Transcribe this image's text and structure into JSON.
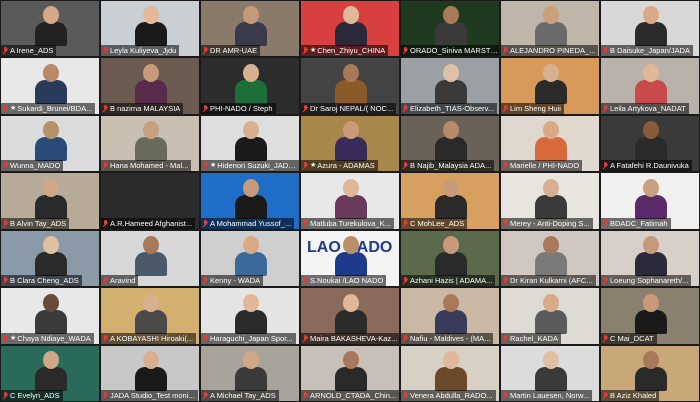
{
  "participants": [
    {
      "name": "A Irene_ADS",
      "bg": "#5a5a5a",
      "shirt": "#222222",
      "skin": "#d6a88a"
    },
    {
      "name": "Leyla Kuliyeva_Jjdu",
      "bg": "#c9cfd3",
      "shirt": "#1a1a1a",
      "skin": "#e3b99a"
    },
    {
      "name": "DR AMR-UAE",
      "bg": "#8a7a6a",
      "shirt": "#3a3a4a",
      "skin": "#c49a7a"
    },
    {
      "name": "Chen_Zhiyu_CHINA",
      "bg": "#d84040",
      "shirt": "#2a2a3a",
      "skin": "#e0b898",
      "star": true
    },
    {
      "name": "ORADO_Siniva MARSTE...",
      "bg": "#1f3a1f",
      "shirt": "#3a3a3a",
      "skin": "#a87a5a"
    },
    {
      "name": "ALEJANDRO PINEDA_...",
      "bg": "#bfb5a8",
      "shirt": "#6a6a6a",
      "skin": "#c9a07a"
    },
    {
      "name": "B Daisuke_Japan/JADA",
      "bg": "#d8d8d8",
      "shirt": "#2a2a2a",
      "skin": "#d8aa88"
    },
    {
      "name": "Sukardi_Brunei/BDA...",
      "bg": "#e8e8e8",
      "shirt": "#2a3a5a",
      "skin": "#b88a6a",
      "star": true
    },
    {
      "name": "B nazima MALAYSIA",
      "bg": "#6a5a50",
      "shirt": "#5a2a4a",
      "skin": "#c89a7a"
    },
    {
      "name": "PHI-NADO / Steph",
      "bg": "#2c2c2c",
      "shirt": "#1e6e3a",
      "skin": "#d8b090"
    },
    {
      "name": "Dr Saroj NEPAL/( NOC...",
      "bg": "#444444",
      "shirt": "#8a5a2a",
      "skin": "#a8785a"
    },
    {
      "name": "Elizabeth_TIAS-Observ...",
      "bg": "#9aa0a4",
      "shirt": "#3a3a3a",
      "skin": "#e0c0a8"
    },
    {
      "name": "Lim Sheng Huii",
      "bg": "#d89a5a",
      "shirt": "#2a2a2a",
      "skin": "#d8b090"
    },
    {
      "name": "Leila Artykova_NADAT",
      "bg": "#b8b2aa",
      "shirt": "#c84a4a",
      "skin": "#e0b898"
    },
    {
      "name": "Wunna_MADO",
      "bg": "#dcdcdc",
      "shirt": "#2a4a7a",
      "skin": "#b8906a"
    },
    {
      "name": "Hana Mohamed - Mal...",
      "bg": "#c8bfb0",
      "shirt": "#6a6a5a",
      "skin": "#c8a080"
    },
    {
      "name": "Hidenori Suzuki_JADA S...",
      "bg": "#dedede",
      "shirt": "#1a1a1a",
      "skin": "#d8b090",
      "star": true
    },
    {
      "name": "Azura - ADAMAS",
      "bg": "#a8884a",
      "shirt": "#3a2a5a",
      "skin": "#c89a7a",
      "star": true
    },
    {
      "name": "B Najib_Malaysia ADA...",
      "bg": "#6a6258",
      "shirt": "#2a2a2a",
      "skin": "#b88a6a"
    },
    {
      "name": "Marielle / PHI-NADO",
      "bg": "#e0d8ce",
      "shirt": "#d86a3a",
      "skin": "#d8aa88"
    },
    {
      "name": "A Fatafehi R.Daunivuka",
      "bg": "#3a3a3a",
      "shirt": "#2a2a2a",
      "skin": "#8a5a3a"
    },
    {
      "name": "B Alvin Tay_ADS",
      "bg": "#b8aa98",
      "shirt": "#2a2a2a",
      "skin": "#d0a888"
    },
    {
      "name": "A.R.Hameed Afghanist...",
      "bg": "#2b2b2b",
      "shirt": "#2b2b2b",
      "skin": "#2b2b2b",
      "empty": true
    },
    {
      "name": "A Mohammad Yussof_...",
      "bg": "#1e6ec8",
      "shirt": "#1a1a1a",
      "skin": "#c49a7a"
    },
    {
      "name": "Matluba Turekulova_K...",
      "bg": "#e8e8e8",
      "shirt": "#6a3a5a",
      "skin": "#e0b898"
    },
    {
      "name": "C MohLee_ADS",
      "bg": "#d8a060",
      "shirt": "#2a2a2a",
      "skin": "#c89a7a"
    },
    {
      "name": "Merey - Anti-Doping S...",
      "bg": "#e8e4de",
      "shirt": "#3a3a3a",
      "skin": "#d8b090"
    },
    {
      "name": "BDADC_Fatimah",
      "bg": "#f0f0f0",
      "shirt": "#5a2a6a",
      "skin": "#c8a080"
    },
    {
      "name": "B Clara Cheng_ADS",
      "bg": "#8a9aa8",
      "shirt": "#2a2a2a",
      "skin": "#e0c0a0"
    },
    {
      "name": "Aravind",
      "bg": "#d8d8d8",
      "shirt": "#4a5a6a",
      "skin": "#a8785a"
    },
    {
      "name": "Kenny - WADA",
      "bg": "#cfcfcf",
      "shirt": "#3a6a9a",
      "skin": "#d8aa88"
    },
    {
      "name": "S.Noukai /LAO NADO",
      "bg": "#f4f4f4",
      "shirt": "#1e3a8a",
      "skin": "#b8906a",
      "logo": "LAO NADO"
    },
    {
      "name": "Azhani Hazis | ADAMA...",
      "bg": "#5a6a4a",
      "shirt": "#2a2a2a",
      "skin": "#c89a7a"
    },
    {
      "name": "Dr Kiran Kulkarni (AFC...",
      "bg": "#d0c8c0",
      "shirt": "#7a7a7a",
      "skin": "#a8785a"
    },
    {
      "name": "Loeung Sophanareth/...",
      "bg": "#d8d0c8",
      "shirt": "#2a2a3a",
      "skin": "#c49a7a"
    },
    {
      "name": "Chaya Ndiaye_WADA",
      "bg": "#e8e8e8",
      "shirt": "#3a3a3a",
      "skin": "#6a4a3a",
      "star": true
    },
    {
      "name": "A KOBAYASHI Hiroaki(...",
      "bg": "#d4b070",
      "shirt": "#4a4a4a",
      "skin": "#d8b090"
    },
    {
      "name": "Haraguchi_Japan Spor...",
      "bg": "#e4e4e4",
      "shirt": "#2a2a2a",
      "skin": "#e0b898"
    },
    {
      "name": "Maira BAKASHEVA-Kaz...",
      "bg": "#8a6a5a",
      "shirt": "#2a2a2a",
      "skin": "#e0b898"
    },
    {
      "name": "Nafiu - Maldives - (MA...",
      "bg": "#c8b8a4",
      "shirt": "#3a3a5a",
      "skin": "#a8785a"
    },
    {
      "name": "Rachel_KADA",
      "bg": "#dedad4",
      "shirt": "#5a5a5a",
      "skin": "#d8aa88"
    },
    {
      "name": "C Mai_DCAT",
      "bg": "#8a8070",
      "shirt": "#1a1a1a",
      "skin": "#c89a7a"
    },
    {
      "name": "C Evelyn_ADS",
      "bg": "#2a6a5a",
      "shirt": "#2a2a2a",
      "skin": "#d0a888"
    },
    {
      "name": "JADA Studio_Test moni...",
      "bg": "#c8c8c8",
      "shirt": "#1a1a1a",
      "skin": "#d8b090"
    },
    {
      "name": "A Michael Tay_ADS",
      "bg": "#a8a49c",
      "shirt": "#3a3a3a",
      "skin": "#d0a888"
    },
    {
      "name": "ARNOLD_CTADA_Chin...",
      "bg": "#c8c0b8",
      "shirt": "#2a2a2a",
      "skin": "#a8785a"
    },
    {
      "name": "Venera Abdulla_RADO...",
      "bg": "#d8d0c4",
      "shirt": "#6a4a2a",
      "skin": "#e0b898"
    },
    {
      "name": "Martin Lauesen, Norw...",
      "bg": "#dcdcdc",
      "shirt": "#3a3a3a",
      "skin": "#e0c0a0"
    },
    {
      "name": "B Aziz Khaled",
      "bg": "#c8a878",
      "shirt": "#2a2a2a",
      "skin": "#a8785a"
    }
  ],
  "icons": {
    "mute": "mic-muted-icon",
    "star": "star-icon"
  },
  "colors": {
    "mute_icon": "#e23b3b",
    "name_bar": "#000000",
    "name_text": "#ffffff"
  }
}
